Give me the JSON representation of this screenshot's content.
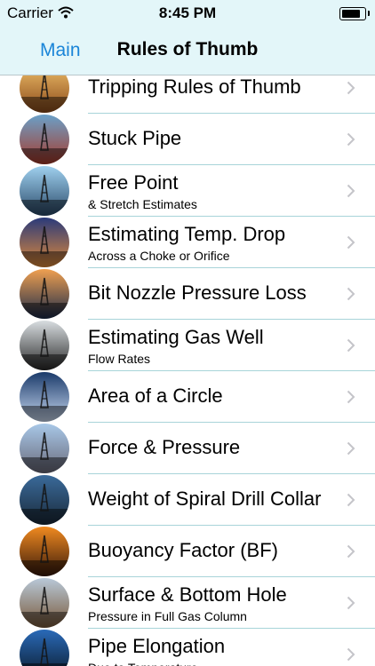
{
  "status": {
    "carrier": "Carrier",
    "time": "8:45 PM",
    "battery_level": 0.85
  },
  "nav": {
    "back_label": "Main",
    "title": "Rules of Thumb"
  },
  "items": [
    {
      "label": "Tripping Rules of Thumb",
      "sub": "",
      "icon": "oil-derrick-sunset-icon",
      "colors": [
        "#f0c06a",
        "#8a4a1a"
      ]
    },
    {
      "label": "Stuck Pipe",
      "sub": "",
      "icon": "drill-ship-icon",
      "colors": [
        "#6aa0c8",
        "#a83a2a"
      ]
    },
    {
      "label": "Free Point",
      "sub": "& Stretch Estimates",
      "icon": "offshore-platform-icon",
      "colors": [
        "#9fd0ee",
        "#2a4a6a"
      ]
    },
    {
      "label": "Estimating Temp. Drop",
      "sub": "Across a Choke or Orifice",
      "icon": "platform-night-icon",
      "colors": [
        "#2a3a7a",
        "#e08a3a"
      ]
    },
    {
      "label": "Bit Nozzle Pressure Loss",
      "sub": "",
      "icon": "rig-silhouette-icon",
      "colors": [
        "#f0a050",
        "#1a2a4a"
      ]
    },
    {
      "label": "Estimating Gas Well",
      "sub": "Flow Rates",
      "icon": "worker-silhouette-icon",
      "colors": [
        "#d8dde0",
        "#2a2a2a"
      ]
    },
    {
      "label": "Area of a Circle",
      "sub": "",
      "icon": "rig-ship-night-icon",
      "colors": [
        "#1a3a6a",
        "#c8d8f0"
      ]
    },
    {
      "label": "Force & Pressure",
      "sub": "",
      "icon": "land-rig-icon",
      "colors": [
        "#a8c8e8",
        "#6a6a7a"
      ]
    },
    {
      "label": "Weight of Spiral Drill Collar",
      "sub": "",
      "icon": "pump-jack-icon",
      "colors": [
        "#3a6a9a",
        "#1a2a3a"
      ]
    },
    {
      "label": "Buoyancy Factor (BF)",
      "sub": "",
      "icon": "pump-jack-sunset-icon",
      "colors": [
        "#f08a20",
        "#3a1a0a"
      ]
    },
    {
      "label": "Surface & Bottom Hole",
      "sub": "Pressure in Full Gas Column",
      "icon": "jackup-rig-icon",
      "colors": [
        "#b8c8d8",
        "#7a5a3a"
      ]
    },
    {
      "label": "Pipe Elongation",
      "sub": "Due to Temperature",
      "icon": "workers-sunset-icon",
      "colors": [
        "#2a6ab8",
        "#0a1a2a"
      ]
    }
  ]
}
